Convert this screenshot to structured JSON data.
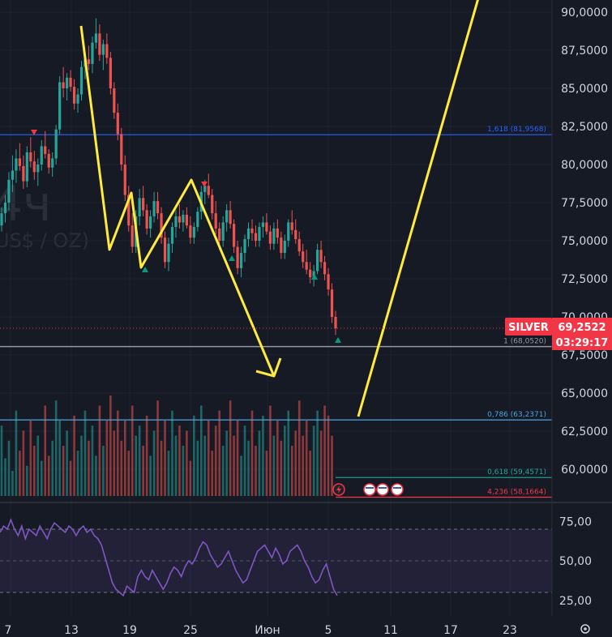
{
  "chart_data": [
    {
      "type": "candlestick",
      "symbol": "SILVER",
      "watermark": {
        "interval": "4ч",
        "unit": "US$ / OZ)"
      },
      "price_axis_ticks": [
        "90,0000",
        "87,5000",
        "85,0000",
        "82,5000",
        "80,0000",
        "77,5000",
        "75,0000",
        "72,5000",
        "70,0000",
        "67,5000",
        "65,0000",
        "62,5000",
        "60,0000"
      ],
      "price_axis_values": [
        90,
        87.5,
        85,
        82.5,
        80,
        77.5,
        75,
        72.5,
        70,
        67.5,
        65,
        62.5,
        60
      ],
      "x_axis_ticks": [
        "7",
        "13",
        "19",
        "25",
        "Июн",
        "5",
        "11",
        "17",
        "23"
      ],
      "current_price": {
        "label": "SILVER",
        "value": "69,2522",
        "countdown": "03:29:17",
        "value_num": 69.2522
      },
      "fib_levels": [
        {
          "label": "1,618 (81,9568)",
          "value": 81.9568,
          "color": "#2962ff"
        },
        {
          "label": "1 (68,0520)",
          "value": 68.052,
          "color": "#9598a1"
        },
        {
          "label": "0,786 (63,2371)",
          "value": 63.2371,
          "color": "#4fa3e0"
        },
        {
          "label": "0,618 (59,4571)",
          "value": 59.4571,
          "color": "#26a69a"
        },
        {
          "label": "4,236 (58,1664)",
          "value": 58.1664,
          "color": "#f23645"
        }
      ],
      "series": [
        {
          "name": "price",
          "values": [
            [
              76.0,
              77.2,
              75.6,
              76.8
            ],
            [
              76.8,
              78.0,
              76.2,
              77.5
            ],
            [
              77.5,
              79.5,
              77.0,
              79.0
            ],
            [
              79.0,
              80.6,
              78.2,
              79.6
            ],
            [
              79.6,
              81.0,
              78.8,
              80.4
            ],
            [
              80.4,
              81.4,
              79.6,
              79.9
            ],
            [
              79.9,
              80.6,
              78.4,
              78.9
            ],
            [
              78.9,
              81.2,
              78.5,
              80.8
            ],
            [
              80.8,
              81.8,
              79.8,
              80.2
            ],
            [
              80.2,
              80.9,
              79.0,
              79.5
            ],
            [
              79.5,
              80.4,
              78.6,
              80.0
            ],
            [
              80.0,
              81.6,
              79.6,
              81.2
            ],
            [
              81.2,
              82.2,
              80.4,
              80.7
            ],
            [
              80.7,
              81.0,
              79.4,
              79.8
            ],
            [
              79.8,
              80.8,
              79.2,
              80.4
            ],
            [
              80.4,
              82.6,
              80.0,
              82.3
            ],
            [
              82.3,
              85.8,
              82.0,
              85.4
            ],
            [
              85.4,
              86.4,
              84.4,
              85.0
            ],
            [
              85.0,
              86.0,
              84.2,
              85.7
            ],
            [
              85.7,
              86.2,
              84.8,
              85.1
            ],
            [
              85.1,
              85.6,
              83.6,
              84.0
            ],
            [
              84.0,
              85.0,
              83.4,
              84.6
            ],
            [
              84.6,
              86.8,
              84.2,
              86.4
            ],
            [
              86.4,
              87.4,
              85.6,
              86.9
            ],
            [
              86.9,
              87.8,
              86.2,
              86.6
            ],
            [
              86.6,
              88.4,
              86.0,
              88.0
            ],
            [
              88.0,
              89.6,
              87.6,
              88.6
            ],
            [
              88.6,
              89.2,
              86.8,
              87.2
            ],
            [
              87.2,
              88.2,
              86.2,
              87.9
            ],
            [
              87.9,
              88.6,
              86.6,
              87.0
            ],
            [
              87.0,
              87.4,
              84.6,
              85.0
            ],
            [
              85.0,
              85.4,
              83.0,
              83.4
            ],
            [
              83.4,
              84.0,
              81.6,
              82.0
            ],
            [
              82.0,
              82.4,
              79.6,
              80.0
            ],
            [
              80.0,
              80.6,
              77.6,
              78.0
            ],
            [
              78.0,
              78.6,
              75.6,
              76.0
            ],
            [
              76.0,
              76.8,
              74.2,
              74.6
            ],
            [
              74.6,
              77.0,
              74.2,
              76.6
            ],
            [
              76.6,
              78.4,
              76.0,
              77.8
            ],
            [
              77.8,
              78.6,
              76.6,
              77.0
            ],
            [
              77.0,
              77.4,
              75.4,
              75.8
            ],
            [
              75.8,
              77.0,
              75.2,
              76.6
            ],
            [
              76.6,
              78.2,
              76.2,
              77.6
            ],
            [
              77.6,
              78.2,
              76.4,
              76.8
            ],
            [
              76.8,
              77.2,
              74.8,
              75.2
            ],
            [
              75.2,
              75.6,
              73.2,
              73.6
            ],
            [
              73.6,
              75.2,
              73.0,
              74.8
            ],
            [
              74.8,
              76.2,
              74.2,
              75.9
            ],
            [
              75.9,
              77.0,
              75.2,
              76.6
            ],
            [
              76.6,
              77.4,
              75.8,
              76.2
            ],
            [
              76.2,
              77.0,
              75.6,
              76.7
            ],
            [
              76.7,
              77.2,
              75.8,
              76.0
            ],
            [
              76.0,
              76.6,
              74.8,
              75.2
            ],
            [
              75.2,
              76.2,
              74.8,
              75.9
            ],
            [
              75.9,
              77.2,
              75.6,
              76.9
            ],
            [
              76.9,
              78.6,
              76.4,
              78.2
            ],
            [
              78.2,
              79.0,
              77.4,
              78.6
            ],
            [
              78.6,
              79.4,
              77.8,
              78.0
            ],
            [
              78.0,
              78.4,
              76.4,
              76.8
            ],
            [
              76.8,
              77.6,
              75.4,
              75.8
            ],
            [
              75.8,
              76.2,
              74.4,
              75.0
            ],
            [
              75.0,
              76.6,
              74.6,
              76.2
            ],
            [
              76.2,
              77.4,
              75.6,
              77.0
            ],
            [
              77.0,
              77.6,
              75.8,
              76.1
            ],
            [
              76.1,
              76.4,
              74.2,
              74.6
            ],
            [
              74.6,
              75.0,
              72.8,
              73.2
            ],
            [
              73.2,
              74.6,
              72.6,
              74.2
            ],
            [
              74.2,
              75.4,
              73.6,
              75.1
            ],
            [
              75.1,
              76.2,
              74.6,
              75.8
            ],
            [
              75.8,
              76.4,
              75.0,
              75.5
            ],
            [
              75.5,
              76.0,
              74.6,
              75.0
            ],
            [
              75.0,
              76.2,
              74.6,
              75.9
            ],
            [
              75.9,
              76.6,
              75.2,
              76.2
            ],
            [
              76.2,
              76.8,
              75.4,
              75.6
            ],
            [
              75.6,
              76.0,
              74.4,
              74.8
            ],
            [
              74.8,
              76.2,
              74.4,
              75.8
            ],
            [
              75.8,
              76.4,
              74.8,
              75.2
            ],
            [
              75.2,
              75.6,
              73.8,
              74.2
            ],
            [
              74.2,
              75.4,
              73.8,
              75.0
            ],
            [
              75.0,
              76.4,
              74.6,
              76.2
            ],
            [
              76.2,
              77.0,
              75.4,
              75.7
            ],
            [
              75.7,
              76.4,
              74.8,
              75.1
            ],
            [
              75.1,
              75.6,
              74.0,
              74.3
            ],
            [
              74.3,
              74.8,
              73.2,
              73.6
            ],
            [
              73.6,
              74.4,
              72.8,
              73.1
            ],
            [
              73.1,
              73.6,
              72.2,
              72.6
            ],
            [
              72.6,
              73.4,
              72.0,
              73.0
            ],
            [
              73.0,
              74.8,
              72.8,
              74.4
            ],
            [
              74.4,
              75.0,
              73.2,
              73.6
            ],
            [
              73.6,
              74.0,
              72.4,
              72.8
            ],
            [
              72.8,
              73.2,
              71.4,
              71.8
            ],
            [
              71.8,
              72.2,
              69.6,
              70.0
            ],
            [
              70.0,
              70.4,
              68.8,
              69.25
            ]
          ]
        },
        {
          "name": "volume",
          "values": [
            28,
            15,
            22,
            10,
            34,
            18,
            26,
            12,
            30,
            20,
            24,
            14,
            36,
            16,
            22,
            38,
            30,
            20,
            26,
            14,
            32,
            18,
            24,
            34,
            22,
            28,
            16,
            36,
            20,
            30,
            40,
            26,
            34,
            22,
            30,
            18,
            36,
            24,
            28,
            20,
            32,
            16,
            26,
            38,
            22,
            30,
            18,
            34,
            24,
            28,
            20,
            26,
            14,
            32,
            22,
            36,
            24,
            30,
            18,
            28,
            34,
            20,
            26,
            38,
            24,
            30,
            16,
            28,
            22,
            34,
            20,
            26,
            32,
            18,
            36,
            24,
            30,
            22,
            28,
            34,
            20,
            26,
            38,
            24,
            30,
            18,
            28,
            34,
            26,
            36,
            32,
            24
          ]
        },
        {
          "name": "rsi",
          "values": [
            68,
            72,
            70,
            76,
            70,
            66,
            72,
            64,
            70,
            68,
            66,
            72,
            68,
            64,
            70,
            74,
            72,
            70,
            68,
            72,
            70,
            66,
            70,
            72,
            68,
            70,
            66,
            64,
            60,
            52,
            44,
            36,
            32,
            30,
            28,
            34,
            32,
            30,
            40,
            44,
            40,
            38,
            44,
            40,
            36,
            32,
            36,
            42,
            46,
            44,
            40,
            46,
            50,
            48,
            52,
            58,
            62,
            60,
            54,
            50,
            46,
            48,
            52,
            56,
            50,
            44,
            40,
            36,
            38,
            44,
            50,
            56,
            58,
            60,
            56,
            52,
            58,
            54,
            48,
            50,
            56,
            58,
            60,
            56,
            50,
            46,
            40,
            36,
            38,
            44,
            48,
            40,
            32,
            28
          ]
        }
      ],
      "rsi_axis_ticks": [
        "75,00",
        "50,00",
        "25,00"
      ],
      "rsi_axis_values": [
        75,
        50,
        25
      ],
      "rsi_band": [
        70,
        30
      ]
    }
  ]
}
